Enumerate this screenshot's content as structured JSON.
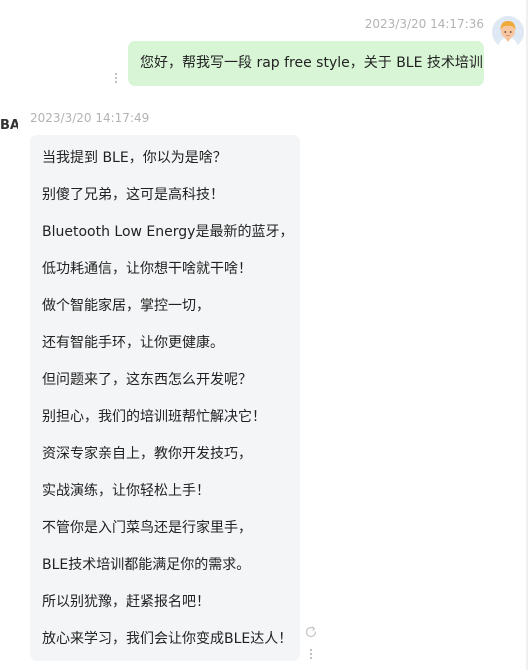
{
  "user_message": {
    "timestamp": "2023/3/20 14:17:36",
    "text": "您好，帮我写一段 rap free style，关于 BLE 技术培训"
  },
  "bot_message": {
    "logo_text": "BAI",
    "timestamp": "2023/3/20 14:17:49",
    "lines": [
      "当我提到 BLE，你以为是啥？",
      "别傻了兄弟，这可是高科技！",
      "Bluetooth Low Energy是最新的蓝牙，",
      "低功耗通信，让你想干啥就干啥！",
      "做个智能家居，掌控一切，",
      "还有智能手环，让你更健康。",
      "但问题来了，这东西怎么开发呢？",
      "别担心，我们的培训班帮忙解决它！",
      "资深专家亲自上，教你开发技巧，",
      "实战演练，让你轻松上手！",
      "不管你是入门菜鸟还是行家里手，",
      "BLE技术培训都能满足你的需求。",
      "所以别犹豫，赶紧报名吧！",
      "放心来学习，我们会让你变成BLE达人！"
    ]
  },
  "icons": {
    "avatar": "user-avatar-icon",
    "more": "more-vertical-icon",
    "regenerate": "refresh-icon"
  },
  "colors": {
    "user_bubble": "#d8f6d6",
    "bot_bubble": "#f4f5f7",
    "timestamp": "#b3b3b3"
  }
}
